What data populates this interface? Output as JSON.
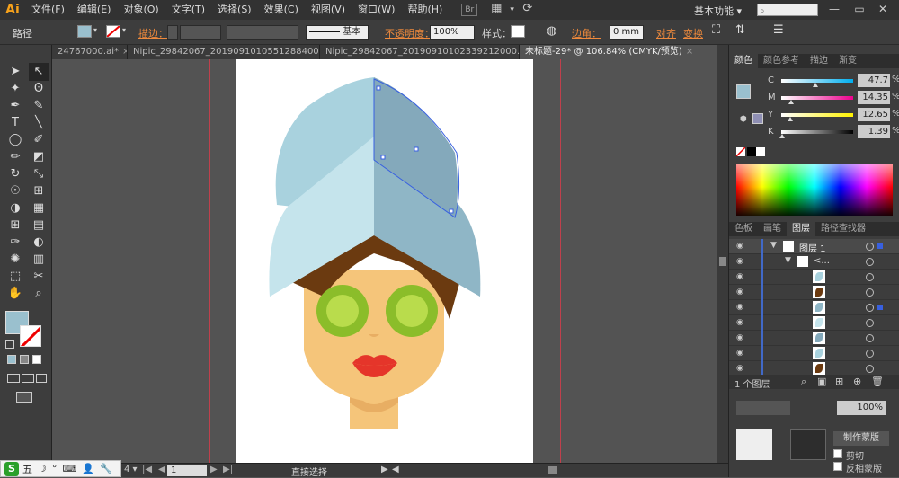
{
  "app": {
    "logo": "Ai"
  },
  "menu": [
    "文件(F)",
    "编辑(E)",
    "对象(O)",
    "文字(T)",
    "选择(S)",
    "效果(C)",
    "视图(V)",
    "窗口(W)",
    "帮助(H)"
  ],
  "menubar_icons": {
    "br": "Br",
    "arrange": "▦",
    "arrange_caret": "▾",
    "sync": "⟳"
  },
  "workspace": {
    "label": "基本功能",
    "caret": "▾"
  },
  "window_controls": {
    "minimize": "—",
    "maximize": "▭",
    "close": "✕"
  },
  "control_bar": {
    "mode_label": "路径",
    "stroke_label": "描边：",
    "stroke_style": "基本",
    "opacity_label": "不透明度：",
    "opacity_value": "100%",
    "style_label": "样式：",
    "corner_label": "边角：",
    "corner_value": "0 mm",
    "align_label": "对齐",
    "transform_label": "变换",
    "fill_color": "#9ac0ce"
  },
  "tabs": [
    {
      "label": "24767000.ai*",
      "close": "×",
      "active": false
    },
    {
      "label": "Nipic_29842067_20190910105512884000.ai*",
      "close": "×",
      "active": false
    },
    {
      "label": "Nipic_29842067_20190910102339212000.ai*",
      "close": "×",
      "active": false
    },
    {
      "label": "未标题-29* @ 106.84% (CMYK/预览)",
      "close": "×",
      "active": true
    }
  ],
  "tools": [
    {
      "name": "selection-tool",
      "glyph": "➤"
    },
    {
      "name": "direct-selection-tool",
      "glyph": "↖"
    },
    {
      "name": "magic-wand-tool",
      "glyph": "✦"
    },
    {
      "name": "lasso-tool",
      "glyph": "ʘ"
    },
    {
      "name": "pen-tool",
      "glyph": "✒"
    },
    {
      "name": "curvature-tool",
      "glyph": "✎"
    },
    {
      "name": "type-tool",
      "glyph": "T"
    },
    {
      "name": "line-tool",
      "glyph": "╲"
    },
    {
      "name": "ellipse-tool",
      "glyph": "◯"
    },
    {
      "name": "paintbrush-tool",
      "glyph": "✐"
    },
    {
      "name": "pencil-tool",
      "glyph": "✏"
    },
    {
      "name": "eraser-tool",
      "glyph": "◩"
    },
    {
      "name": "rotate-tool",
      "glyph": "↻"
    },
    {
      "name": "scale-tool",
      "glyph": "⤡"
    },
    {
      "name": "warp-tool",
      "glyph": "☉"
    },
    {
      "name": "free-transform-tool",
      "glyph": "⊞"
    },
    {
      "name": "shape-builder-tool",
      "glyph": "◑"
    },
    {
      "name": "perspective-grid-tool",
      "glyph": "▦"
    },
    {
      "name": "mesh-tool",
      "glyph": "⊞"
    },
    {
      "name": "gradient-tool",
      "glyph": "▤"
    },
    {
      "name": "eyedropper-tool",
      "glyph": "✑"
    },
    {
      "name": "blend-tool",
      "glyph": "◐"
    },
    {
      "name": "symbol-sprayer-tool",
      "glyph": "✺"
    },
    {
      "name": "column-graph-tool",
      "glyph": "▥"
    },
    {
      "name": "artboard-tool",
      "glyph": "⬚"
    },
    {
      "name": "slice-tool",
      "glyph": "✂"
    },
    {
      "name": "hand-tool",
      "glyph": "✋"
    },
    {
      "name": "zoom-tool",
      "glyph": "⌕"
    }
  ],
  "color_panel": {
    "tabs": [
      "颜色",
      "颜色参考",
      "描边",
      "渐变"
    ],
    "fill_color": "#9ac0ce",
    "sliders": [
      {
        "label": "C",
        "value": "47.7",
        "unit": "%"
      },
      {
        "label": "M",
        "value": "14.35",
        "unit": "%"
      },
      {
        "label": "Y",
        "value": "12.65",
        "unit": "%"
      },
      {
        "label": "K",
        "value": "1.39",
        "unit": "%"
      }
    ]
  },
  "layers_panel": {
    "tabs": [
      "色板",
      "画笔",
      "图层",
      "路径查找器"
    ],
    "layer_name": "图层 1",
    "group_name": "<...",
    "footer": "1 个图层",
    "row_count": 9
  },
  "bottom_panel": {
    "make_mask": "制作蒙版",
    "clip_label": "剪切",
    "invert_label": "反相蒙版",
    "opacity_value": "100%"
  },
  "status": {
    "zoom": "106.84%",
    "page": "1",
    "tool": "直接选择"
  },
  "ime": {
    "label": "五",
    "icons": [
      "☽",
      "°",
      "⌨",
      "👤",
      "🔧"
    ]
  },
  "colors": {
    "towel_light": "#a9d2de",
    "towel_mid": "#c5e4ec",
    "towel_dark": "#8fb6c6",
    "towel_darker": "#84a9bb",
    "hair": "#6b3a10",
    "skin": "#f5c57a",
    "neck": "#e8ae63",
    "cucumber_outer": "#8bbd2a",
    "cucumber_inner": "#b9dc4c",
    "lips": "#e5352a",
    "selection": "#3860e0"
  }
}
